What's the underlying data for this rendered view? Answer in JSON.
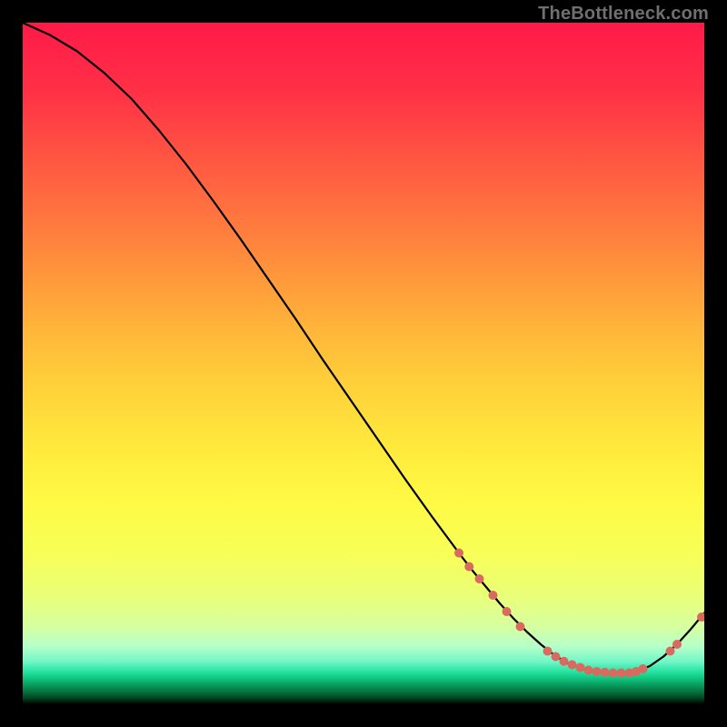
{
  "watermark": {
    "text": "TheBottleneck.com"
  },
  "colors": {
    "line": "#000000",
    "marker": "#d86a5f",
    "black": "#000000"
  },
  "chart_data": {
    "type": "line",
    "title": "",
    "xlabel": "",
    "ylabel": "",
    "xlim": [
      0,
      100
    ],
    "ylim": [
      0,
      100
    ],
    "grid": false,
    "legend": false,
    "background": {
      "type": "multi-stop-gradient",
      "stops": [
        {
          "y_frac": 0.0,
          "color": "#ff1a49"
        },
        {
          "y_frac": 0.1,
          "color": "#ff3046"
        },
        {
          "y_frac": 0.2,
          "color": "#ff5642"
        },
        {
          "y_frac": 0.3,
          "color": "#ff7b3e"
        },
        {
          "y_frac": 0.38,
          "color": "#ff9a3b"
        },
        {
          "y_frac": 0.45,
          "color": "#ffb53a"
        },
        {
          "y_frac": 0.53,
          "color": "#ffd03a"
        },
        {
          "y_frac": 0.62,
          "color": "#ffe93c"
        },
        {
          "y_frac": 0.7,
          "color": "#fff944"
        },
        {
          "y_frac": 0.78,
          "color": "#f7ff58"
        },
        {
          "y_frac": 0.84,
          "color": "#eaff77"
        },
        {
          "y_frac": 0.885,
          "color": "#d7ffa0"
        },
        {
          "y_frac": 0.915,
          "color": "#b6ffc9"
        },
        {
          "y_frac": 0.937,
          "color": "#73f7c8"
        },
        {
          "y_frac": 0.952,
          "color": "#27e3a2"
        },
        {
          "y_frac": 0.962,
          "color": "#0fc57f"
        },
        {
          "y_frac": 0.972,
          "color": "#0a9a5e"
        },
        {
          "y_frac": 0.982,
          "color": "#06703e"
        },
        {
          "y_frac": 0.99,
          "color": "#034a24"
        },
        {
          "y_frac": 1.0,
          "color": "#000000"
        }
      ]
    },
    "series": [
      {
        "name": "curve",
        "x": [
          0,
          4,
          8,
          12,
          16,
          20,
          24,
          28,
          32,
          36,
          40,
          44,
          48,
          52,
          56,
          60,
          64,
          66,
          68,
          70,
          72,
          74,
          76,
          78,
          80,
          82,
          84,
          86,
          88,
          90,
          92,
          94,
          96,
          98,
          100
        ],
        "y": [
          100.0,
          98.2,
          95.8,
          92.6,
          88.8,
          84.2,
          79.2,
          73.8,
          68.2,
          62.4,
          56.6,
          50.6,
          44.8,
          39.0,
          33.2,
          27.6,
          22.2,
          19.6,
          17.2,
          14.8,
          12.6,
          10.6,
          8.8,
          7.2,
          6.0,
          5.2,
          4.7,
          4.5,
          4.5,
          4.8,
          5.6,
          7.0,
          8.8,
          11.0,
          13.4
        ]
      }
    ],
    "markers": {
      "description": "highlighted points on the curve in the low region",
      "x": [
        64.0,
        65.5,
        67.0,
        69.0,
        71.0,
        73.0,
        77.0,
        78.2,
        79.4,
        80.6,
        81.8,
        83.0,
        84.2,
        85.4,
        86.6,
        87.8,
        89.0,
        90.0,
        91.0,
        95.0,
        96.0,
        99.6
      ],
      "y": [
        22.2,
        20.2,
        18.4,
        16.0,
        13.6,
        11.4,
        7.8,
        7.0,
        6.3,
        5.8,
        5.4,
        5.0,
        4.8,
        4.7,
        4.6,
        4.6,
        4.6,
        4.8,
        5.2,
        7.8,
        8.8,
        12.8
      ],
      "radius": 5
    }
  }
}
